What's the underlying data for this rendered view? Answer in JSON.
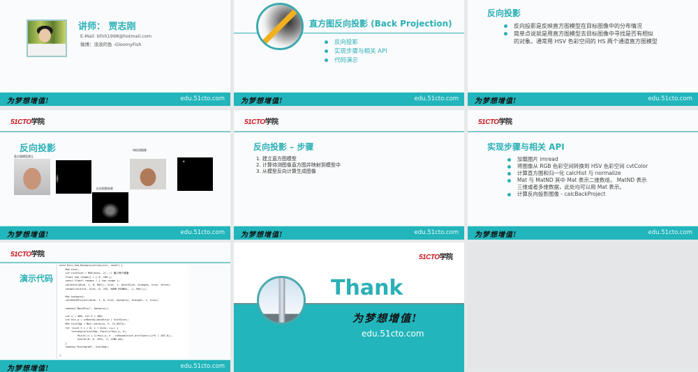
{
  "common": {
    "motto": "为梦想增值!",
    "url": "edu.51cto.com",
    "logo_red": "51CTO",
    "logo_dark": "学院"
  },
  "slides": [
    {
      "title": "讲师：  贾志刚",
      "email": "E-Mail: bfnh1998@hotmail.com",
      "weibo": "微博：流浪的鱼 -GloomyFish"
    },
    {
      "title": "直方图反向投影 (Back Projection)",
      "bullets": [
        "反向投影",
        "实现步骤与相关 API",
        "代码演示"
      ]
    },
    {
      "title": "反向投影",
      "bullets": [
        "反向投影是反映直方图模型在目标图像中的分布情况",
        "简单点说就是用直方图模型去目标图像中寻找是否有相似",
        "的对象。通常用 HSV 色彩空间的 HS 两个通道直方图模型"
      ]
    },
    {
      "title": "反向投影",
      "labels": {
        "model": "直方图模型建立",
        "result": "反向投影结果",
        "test": "待检测图像"
      }
    },
    {
      "title": "反向投影 – 步骤",
      "steps": [
        "1. 建立直方图模型",
        "2. 计算待测图像直方图并映射到模型中",
        "3. 从模型反向计算生成图像"
      ]
    },
    {
      "title": "实现步骤与相关 API",
      "bullets": [
        "加载图片 imread",
        "将图像从 RGB 色彩空间转换到 HSV 色彩空间 cvtColor",
        "计算直方图和归一化 calcHist 与 normalize",
        "Mat 与 MatND 其中 Mat 表示二维数组， MatND 表示",
        "三维或者多维数据，此处均可以用 Mat 表示。",
        "计算反向投影图像  - calcBackProject"
      ]
    },
    {
      "title": "演示代码",
      "code": "void Hist_And_Backprojection(int, void*) {\n    Mat hist;\n    int histSize = MAX(bins, 2); // 最少两个维度\n    float hue_range[] = { 0, 180 };\n    const float* ranges = { hue_range };\n    calcHist(&hue, 1, 0, Mat(), hist, 1, &histSize, &ranges, true, false);\n    normalize(hist, hist, 0, 255, NORM_MINMAX, -1, Mat());\n\n    Mat backproj;\n    calcBackProject(&hue, 1, 0, hist, backproj, &ranges, 1, true);\n\n    imshow(\"BackProj\", backproj);\n\n    int w = 400; int h = 400;\n    int bin_w = cvRound((double)w / histSize);\n    Mat histImg = Mat::zeros(w, h, CV_8UC3);\n    for (size_t i = 0; i < bins; i++) {\n        rectangle(histImg, Point(i*bin_w, h),\n            Point((i + 1)*bin_w, h - cvRound(hist.at<float>(i)*h / 255.0)),\n            Scalar(0, 0, 255), 2, LINE_AA);\n    }\n    imshow(\"Histogram\", histImg);\n\n}"
    },
    {
      "title": "Thank"
    }
  ]
}
